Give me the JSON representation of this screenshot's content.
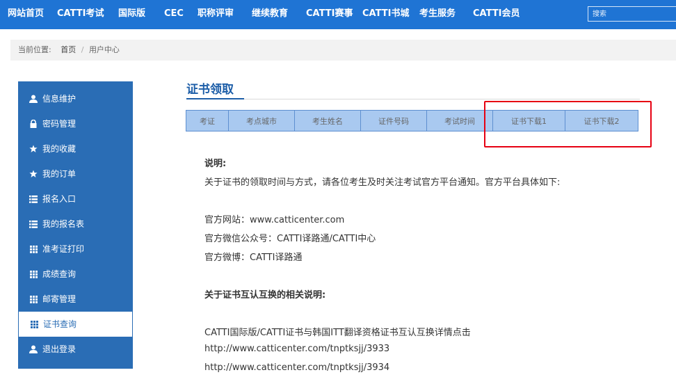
{
  "nav": {
    "items": [
      "网站首页",
      "CATTI考试",
      "国际版",
      "CEC",
      "职称评审",
      "继续教育",
      "CATTI赛事",
      "CATTI书城",
      "考生服务",
      "CATTI会员"
    ],
    "search_placeholder": "搜索"
  },
  "breadcrumb": {
    "prefix": "当前位置:",
    "home": "首页",
    "separator": "/",
    "current": "用户中心"
  },
  "sidebar": {
    "items": [
      {
        "label": "信息维护",
        "icon": "user-icon"
      },
      {
        "label": "密码管理",
        "icon": "lock-icon"
      },
      {
        "label": "我的收藏",
        "icon": "star-icon"
      },
      {
        "label": "我的订单",
        "icon": "star-icon"
      },
      {
        "label": "报名入口",
        "icon": "list-icon"
      },
      {
        "label": "我的报名表",
        "icon": "list-icon"
      },
      {
        "label": "准考证打印",
        "icon": "grid-icon"
      },
      {
        "label": "成绩查询",
        "icon": "grid-icon"
      },
      {
        "label": "邮寄管理",
        "icon": "grid-icon"
      },
      {
        "label": "证书查询",
        "icon": "grid-icon",
        "active": true
      },
      {
        "label": "退出登录",
        "icon": "user-icon"
      }
    ]
  },
  "main": {
    "title": "证书领取",
    "table_headers": [
      "考证",
      "考点城市",
      "考生姓名",
      "证件号码",
      "考试时间",
      "证书下载1",
      "证书下载2"
    ],
    "notes": {
      "heading": "说明:",
      "intro": "关于证书的领取时间与方式，请各位考生及时关注考试官方平台通知。官方平台具体如下:",
      "website": "官方网站：www.catticenter.com",
      "wechat": "官方微信公众号：CATTI译路通/CATTI中心",
      "weibo": "官方微博：CATTI译路通",
      "mutual_heading": "关于证书互认互换的相关说明:",
      "mutual_text": "CATTI国际版/CATTI证书与韩国ITT翻译资格证书互认互换详情点击",
      "link1": "http://www.catticenter.com/tnptksjj/3933",
      "link2": "http://www.catticenter.com/tnptksjj/3934"
    }
  },
  "colors": {
    "nav_bg": "#1f74d4",
    "sidebar_bg": "#2a6db5",
    "title": "#1d5ea8",
    "table_bg": "#a9c9f0",
    "highlight": "#e60012"
  }
}
